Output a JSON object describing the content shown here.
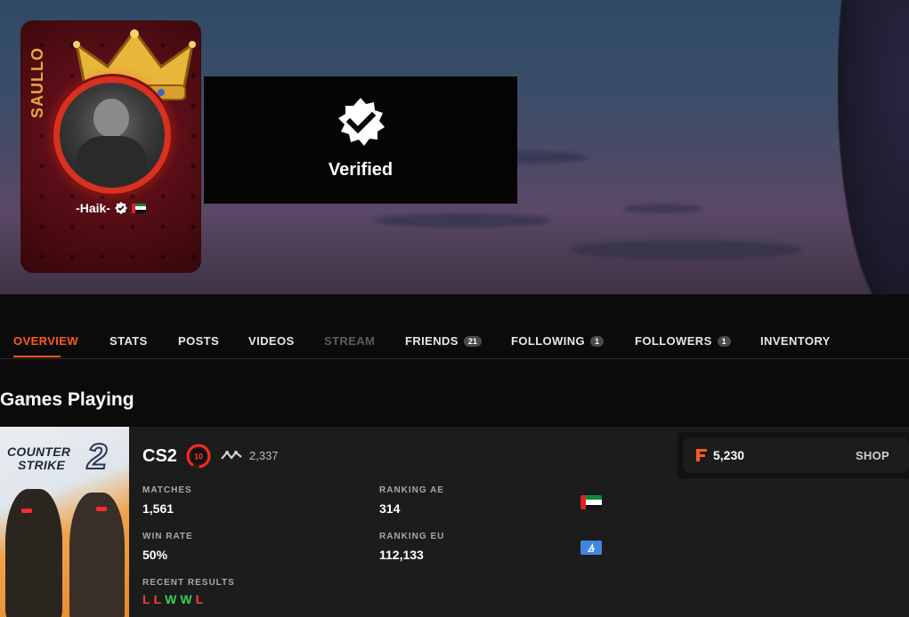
{
  "profile": {
    "vertical_name": "SAULLO",
    "username": "-Haik-",
    "verified_badge_icon": "verified-check-icon",
    "country_flag": "uae-flag-icon"
  },
  "verified_popup": {
    "label": "Verified",
    "icon": "verified-seal-icon"
  },
  "tabs": [
    {
      "label": "OVERVIEW",
      "state": "active"
    },
    {
      "label": "STATS",
      "state": "normal"
    },
    {
      "label": "POSTS",
      "state": "normal"
    },
    {
      "label": "VIDEOS",
      "state": "normal"
    },
    {
      "label": "STREAM",
      "state": "disabled"
    },
    {
      "label": "FRIENDS",
      "count": "21",
      "state": "normal"
    },
    {
      "label": "FOLLOWING",
      "count": "1",
      "state": "normal"
    },
    {
      "label": "FOLLOWERS",
      "count": "1",
      "state": "normal"
    },
    {
      "label": "INVENTORY",
      "state": "normal"
    }
  ],
  "section_title": "Games Playing",
  "game": {
    "cover_text_line1": "COUNTER",
    "cover_text_line2": "STRIKE",
    "cover_number": "2",
    "name": "CS2",
    "level": "10",
    "elo": "2,337",
    "matches_label": "MATCHES",
    "matches": "1,561",
    "win_rate_label": "WIN RATE",
    "win_rate": "50%",
    "ranking_ae_label": "RANKING AE",
    "ranking_ae": "314",
    "ranking_eu_label": "RANKING EU",
    "ranking_eu": "112,133",
    "recent_label": "RECENT RESULTS",
    "recent_results": [
      "L",
      "L",
      "W",
      "W",
      "L"
    ]
  },
  "shop": {
    "points": "5,230",
    "button": "SHOP",
    "icon": "faceit-points-icon"
  },
  "colors": {
    "accent": "#ff5a1f",
    "win": "#33d25a",
    "loss": "#ff3b3b"
  }
}
